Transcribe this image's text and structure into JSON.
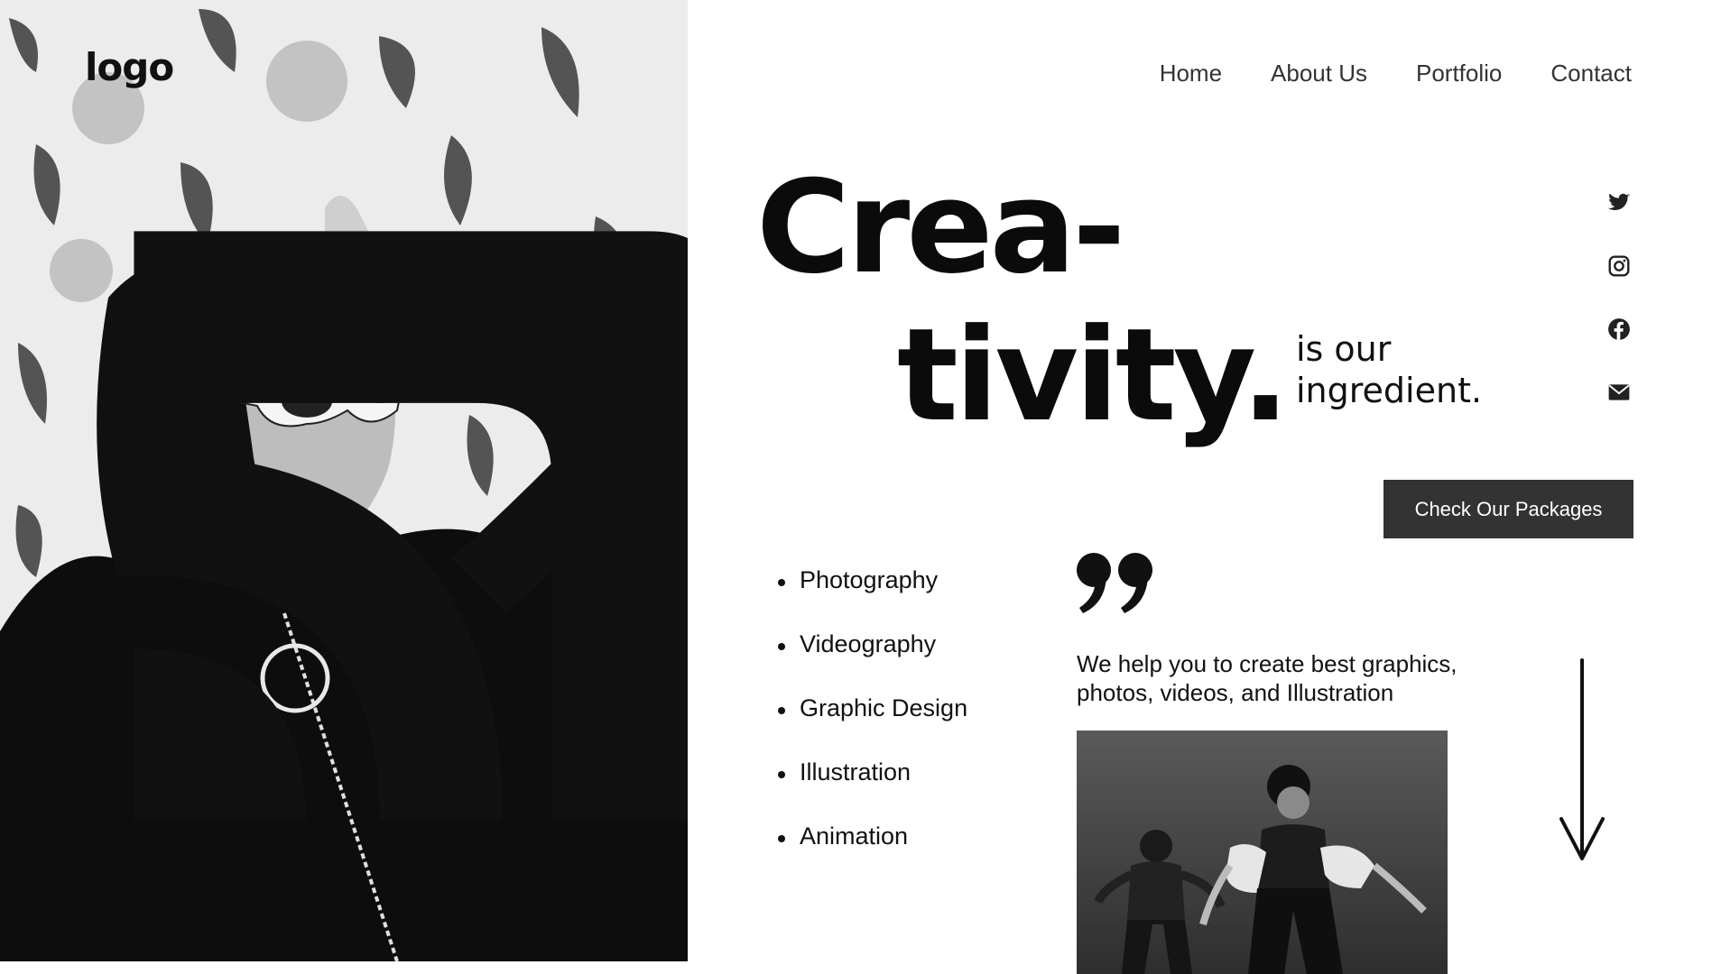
{
  "brand": {
    "logo_text": "logo",
    "logo_icon": "rss-feed-icon"
  },
  "nav": {
    "items": [
      {
        "label": "Home"
      },
      {
        "label": "About Us"
      },
      {
        "label": "Portfolio"
      },
      {
        "label": "Contact"
      }
    ]
  },
  "hero": {
    "headline_line1": "Crea-",
    "headline_line2": "tivity.",
    "tagline": "is our\ningredient."
  },
  "social": [
    {
      "icon": "twitter-icon"
    },
    {
      "icon": "instagram-icon"
    },
    {
      "icon": "facebook-icon"
    },
    {
      "icon": "envelope-icon"
    }
  ],
  "cta": {
    "label": "Check Our Packages"
  },
  "services": [
    "Photography",
    "Videography",
    "Graphic Design",
    "Illustration",
    "Animation"
  ],
  "quote": {
    "icon": "quotation-mark-icon",
    "text": "We help you to create best graphics, photos, videos, and Illustration"
  },
  "images": {
    "hero": "black-and-white photo of woman in hijab and white sunglasses",
    "secondary": "black-and-white photo of two dancers"
  },
  "colors": {
    "accent_button": "#333333",
    "text": "#111111",
    "background": "#ffffff"
  },
  "scroll": {
    "icon": "arrow-down-icon"
  }
}
